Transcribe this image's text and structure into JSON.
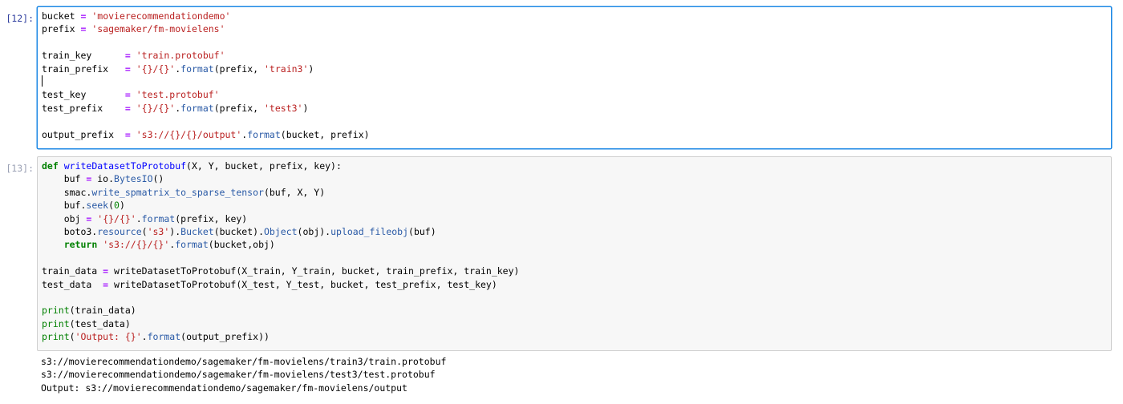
{
  "cells": [
    {
      "prompt": "[12]:",
      "lines": [
        "bucket = 'movierecommendationdemo'",
        "prefix = 'sagemaker/fm-movielens'",
        "",
        "train_key      = 'train.protobuf'",
        "train_prefix   = '{}/{}'.format(prefix, 'train3')",
        "",
        "test_key       = 'test.protobuf'",
        "test_prefix    = '{}/{}'.format(prefix, 'test3')",
        "",
        "output_prefix  = 's3://{}/{}/output'.format(bucket, prefix)"
      ]
    },
    {
      "prompt": "[13]:",
      "lines": [
        "def writeDatasetToProtobuf(X, Y, bucket, prefix, key):",
        "    buf = io.BytesIO()",
        "    smac.write_spmatrix_to_sparse_tensor(buf, X, Y)",
        "    buf.seek(0)",
        "    obj = '{}/{}'.format(prefix, key)",
        "    boto3.resource('s3').Bucket(bucket).Object(obj).upload_fileobj(buf)",
        "    return 's3://{}/{}'.format(bucket,obj)",
        "",
        "train_data = writeDatasetToProtobuf(X_train, Y_train, bucket, train_prefix, train_key)",
        "test_data  = writeDatasetToProtobuf(X_test, Y_test, bucket, test_prefix, test_key)",
        "",
        "print(train_data)",
        "print(test_data)",
        "print('Output: {}'.format(output_prefix))"
      ],
      "output": [
        "s3://movierecommendationdemo/sagemaker/fm-movielens/train3/train.protobuf",
        "s3://movierecommendationdemo/sagemaker/fm-movielens/test3/test.protobuf",
        "Output: s3://movierecommendationdemo/sagemaker/fm-movielens/output"
      ]
    }
  ],
  "colors": {
    "keyword": "#008000",
    "string": "#ba2121",
    "operator": "#aa22ff",
    "selected_border": "#1e88e5"
  }
}
